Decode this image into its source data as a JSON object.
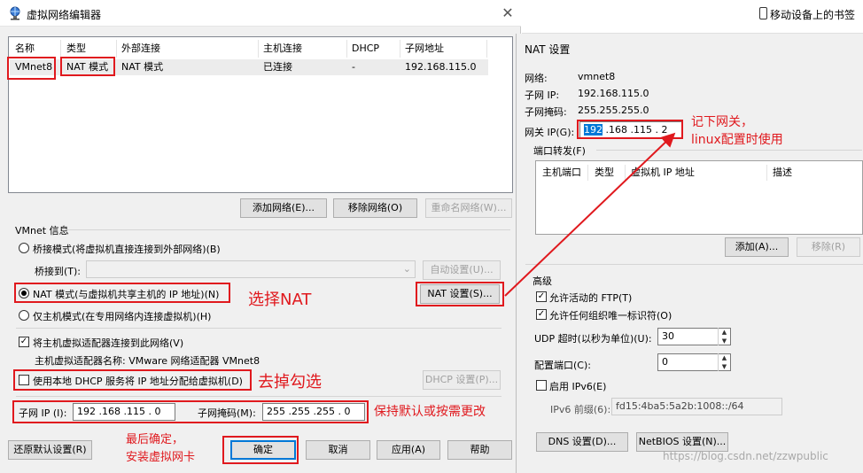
{
  "dialog": {
    "title": "虚拟网络编辑器",
    "close_glyph": "✕",
    "table": {
      "headers": [
        "名称",
        "类型",
        "外部连接",
        "主机连接",
        "DHCP",
        "子网地址"
      ],
      "rows": [
        [
          "VMnet8",
          "NAT 模式",
          "NAT 模式",
          "已连接",
          "-",
          "192.168.115.0"
        ]
      ]
    },
    "buttons": {
      "add_network": "添加网络(E)...",
      "remove_network": "移除网络(O)",
      "rename_network": "重命名网络(W)..."
    },
    "vmnet_info": {
      "group_label": "VMnet 信息",
      "bridged_radio": "桥接模式(将虚拟机直接连接到外部网络)(B)",
      "bridged_to_label": "桥接到(T):",
      "auto_settings": "自动设置(U)...",
      "nat_radio": "NAT 模式(与虚拟机共享主机的 IP 地址)(N)",
      "nat_settings": "NAT 设置(S)...",
      "host_only_radio": "仅主机模式(在专用网络内连接虚拟机)(H)",
      "connect_adapter_check": "将主机虚拟适配器连接到此网络(V)",
      "adapter_name_text": "主机虚拟适配器名称: VMware 网络适配器 VMnet8",
      "dhcp_check": "使用本地 DHCP 服务将 IP 地址分配给虚拟机(D)",
      "dhcp_settings": "DHCP 设置(P)...",
      "subnet_ip_label": "子网 IP (I):",
      "subnet_ip_value": "192 .168 .115 .  0",
      "subnet_mask_label": "子网掩码(M):",
      "subnet_mask_value": "255 .255 .255 .  0"
    },
    "footer": {
      "restore_defaults": "还原默认设置(R)",
      "ok": "确定",
      "cancel": "取消",
      "apply": "应用(A)",
      "help": "帮助"
    }
  },
  "annotations": {
    "select_nat": "选择NAT",
    "uncheck": "去掉勾选",
    "keep_default": "保持默认或按需更改",
    "confirm_line1": "最后确定，",
    "confirm_line2": "安装虚拟网卡",
    "gateway_line1": "记下网关，",
    "gateway_line2": "linux配置时使用",
    "color": "#e0191e"
  },
  "browser": {
    "bookmarks_label": "移动设备上的书签"
  },
  "nat_settings": {
    "title": "NAT 设置",
    "network_label": "网络:",
    "network_value": "vmnet8",
    "subnet_ip_label": "子网 IP:",
    "subnet_ip_value": "192.168.115.0",
    "subnet_mask_label": "子网掩码:",
    "subnet_mask_value": "255.255.255.0",
    "gateway_label": "网关 IP(G):",
    "gateway_first_octet": "192",
    "gateway_rest": " .168 .115 .  2",
    "port_forward_label": "端口转发(F)",
    "pf_headers": [
      "主机端口",
      "类型",
      "虚拟机 IP 地址",
      "描述"
    ],
    "pf_add": "添加(A)...",
    "pf_remove": "移除(R)",
    "advanced_label": "高级",
    "allow_ftp": "允许活动的 FTP(T)",
    "allow_oui": "允许任何组织唯一标识符(O)",
    "udp_timeout_label": "UDP 超时(以秒为单位)(U):",
    "udp_timeout_value": "30",
    "config_port_label": "配置端口(C):",
    "config_port_value": "0",
    "enable_ipv6": "启用 IPv6(E)",
    "ipv6_prefix_label": "IPv6 前缀(6):",
    "ipv6_prefix_value": "fd15:4ba5:5a2b:1008::/64",
    "dns_settings": "DNS 设置(D)...",
    "netbios_settings": "NetBIOS 设置(N)..."
  },
  "watermark": "https://blog.csdn.net/zzwpublic"
}
